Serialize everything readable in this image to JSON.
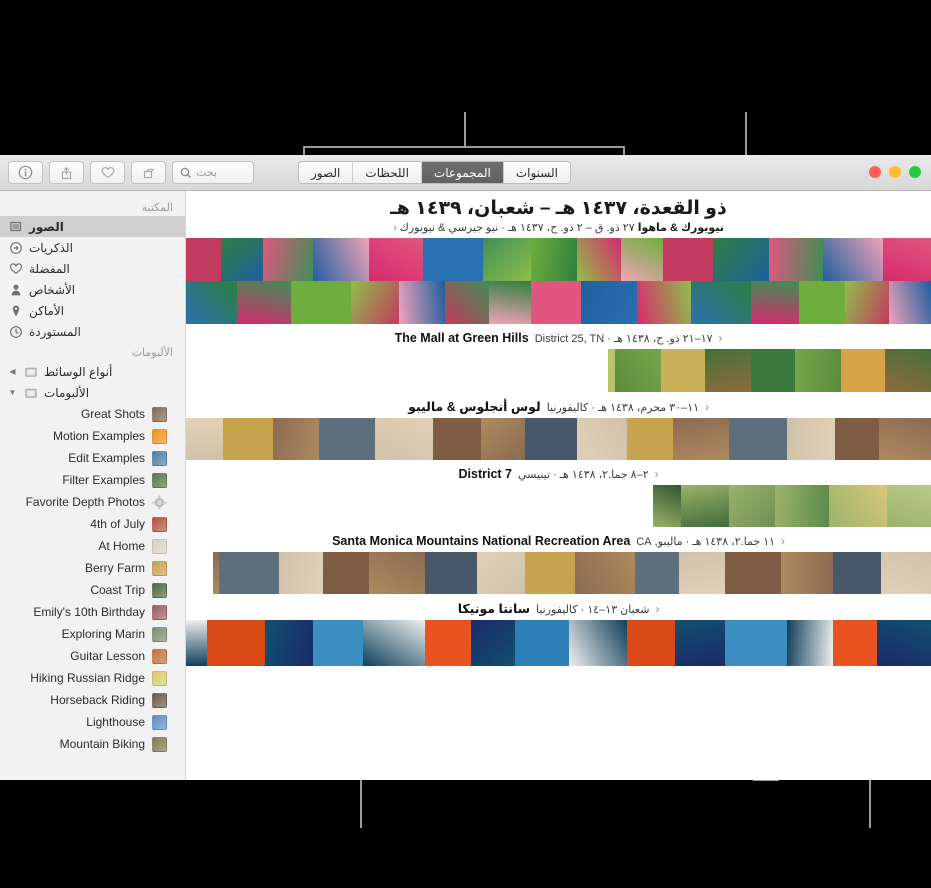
{
  "window": {
    "traffic_lights": [
      "green",
      "yellow",
      "red"
    ]
  },
  "toolbar": {
    "search_placeholder": "بحث",
    "buttons": [
      {
        "name": "search-field",
        "label": "بحث",
        "icon": "search-icon"
      },
      {
        "name": "rotate-button",
        "label": "",
        "icon": "rotate-icon"
      },
      {
        "name": "favorite-button",
        "label": "",
        "icon": "heart-icon"
      },
      {
        "name": "share-button",
        "label": "",
        "icon": "share-icon"
      },
      {
        "name": "info-button",
        "label": "",
        "icon": "info-icon"
      }
    ],
    "tabs": [
      {
        "label": "السنوات",
        "selected": false
      },
      {
        "label": "المجموعات",
        "selected": true
      },
      {
        "label": "اللحظات",
        "selected": false
      },
      {
        "label": "الصور",
        "selected": false
      }
    ]
  },
  "sidebar": {
    "library_header": "المكتبة",
    "library_items": [
      {
        "label": "الصور",
        "icon": "photos-icon",
        "selected": true
      },
      {
        "label": "الذكريات",
        "icon": "memories-icon",
        "selected": false
      },
      {
        "label": "المفضلة",
        "icon": "heart-icon",
        "selected": false
      },
      {
        "label": "الأشخاص",
        "icon": "person-icon",
        "selected": false
      },
      {
        "label": "الأماكن",
        "icon": "pin-icon",
        "selected": false
      },
      {
        "label": "المستوردة",
        "icon": "clock-icon",
        "selected": false
      }
    ],
    "albums_header": "الألبومات",
    "groups": [
      {
        "label": "أنواع الوسائط",
        "icon": "folder-icon",
        "disclosure": "collapsed"
      },
      {
        "label": "الألبومات",
        "icon": "folder-icon",
        "disclosure": "expanded"
      }
    ],
    "albums": [
      {
        "name": "Great Shots",
        "thumb": "#7d6a52"
      },
      {
        "name": "Motion Examples",
        "thumb": "#f2901b"
      },
      {
        "name": "Edit Examples",
        "thumb": "#4c7fa8"
      },
      {
        "name": "Filter Examples",
        "thumb": "#5d7540"
      },
      {
        "name": "Favorite Depth Photos",
        "thumb": "gear-icon"
      },
      {
        "name": "4th of July",
        "thumb": "#b5523f"
      },
      {
        "name": "At Home",
        "thumb": "#d8d2c8"
      },
      {
        "name": "Berry Farm",
        "thumb": "#c9a14a"
      },
      {
        "name": "Coast Trip",
        "thumb": "#4e6a3c"
      },
      {
        "name": "Emily's 10th Birthday",
        "thumb": "#9d5b6a"
      },
      {
        "name": "Exploring Marin",
        "thumb": "#7c8d6d"
      },
      {
        "name": "Guitar Lesson",
        "thumb": "#c4703a"
      },
      {
        "name": "Hiking Russian Ridge",
        "thumb": "#d9cc6a"
      },
      {
        "name": "Horseback Riding",
        "thumb": "#6b5a44"
      },
      {
        "name": "Lighthouse",
        "thumb": "#5b8fc2"
      },
      {
        "name": "Mountain Biking",
        "thumb": "#7f7a52"
      }
    ]
  },
  "main": {
    "title": "ذو القعدة، ١٤٣٧ هـ – شعبان، ١٤٣٩ هـ",
    "subtitle": {
      "place": "نيويورك & ماهوا",
      "meta": "٢٧ ذو. ق – ٢ ذو. ح، ١٤٣٧ هـ · نيو جيرسي & نيويورك",
      "chevron": "‹"
    },
    "sections": [
      {
        "name": "The Mall at Green Hills",
        "meta": "١٧–٢١ ذو. ح، ١٤٣٨ هـ · District 25, TN",
        "chevron": "‹"
      },
      {
        "name": "لوس أنجلوس & ماليبو",
        "meta": "١١–٣٠ محرم، ١٤٣٨ هـ · كاليفورنيا",
        "chevron": "‹"
      },
      {
        "name": "District 7",
        "meta": "٢–٨ جما.٢، ١٤٣٨ هـ · تينيسي",
        "chevron": "‹"
      },
      {
        "name": "Santa Monica Mountains National Recreation Area",
        "meta": "١١ جما.٢، ١٤٣٨ هـ · ماليبو, CA",
        "chevron": "‹"
      },
      {
        "name": "سانتا مونيكا",
        "meta": "شعبان ١٣–١٤ · كاليفورنيا",
        "chevron": "‹"
      }
    ]
  },
  "colors": {
    "selection": "#cfcfcf",
    "tab_active_bg": "#6e6e6e",
    "callout": "#9a9a9a",
    "window_bg": "#ffffff",
    "sidebar_bg": "#f2f2f2",
    "backdrop": "#000000"
  }
}
